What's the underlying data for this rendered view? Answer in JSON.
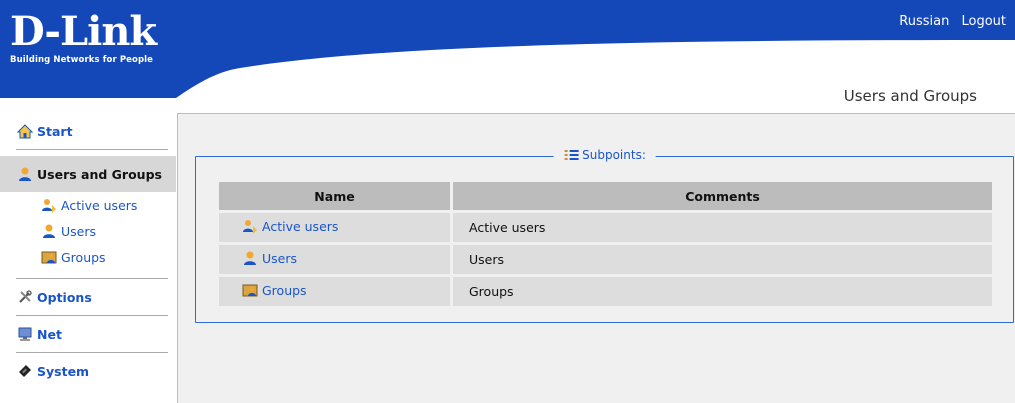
{
  "header": {
    "logo": "D-Link",
    "tagline": "Building Networks for People",
    "links": [
      "Russian",
      "Logout"
    ],
    "page_title": "Users and Groups",
    "colors": {
      "banner": "#1447b8",
      "link": "#1a55c8"
    }
  },
  "sidebar": {
    "sections": [
      {
        "label": "Start",
        "icon": "home-icon"
      },
      {
        "label": "Users and Groups",
        "icon": "users-icon",
        "active": true,
        "items": [
          {
            "label": "Active users",
            "icon": "active-users-icon"
          },
          {
            "label": "Users",
            "icon": "user-icon"
          },
          {
            "label": "Groups",
            "icon": "groups-icon"
          }
        ]
      },
      {
        "label": "Options",
        "icon": "tools-icon"
      },
      {
        "label": "Net",
        "icon": "network-icon"
      },
      {
        "label": "System",
        "icon": "system-icon"
      }
    ]
  },
  "main": {
    "legend": "Subpoints:",
    "columns": [
      "Name",
      "Comments"
    ],
    "rows": [
      {
        "name": "Active users",
        "comment": "Active users",
        "icon": "active-users-icon"
      },
      {
        "name": "Users",
        "comment": "Users",
        "icon": "user-icon"
      },
      {
        "name": "Groups",
        "comment": "Groups",
        "icon": "groups-icon"
      }
    ]
  }
}
